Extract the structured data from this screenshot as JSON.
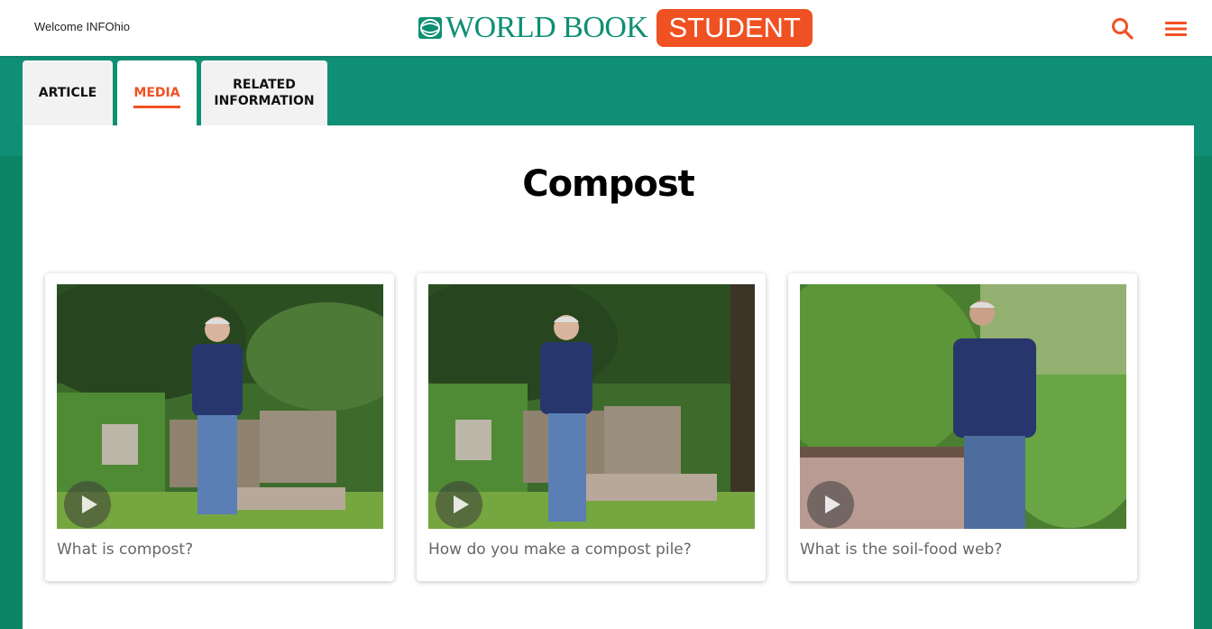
{
  "header": {
    "welcome": "Welcome INFOhio",
    "logo_text": "WORLD BOOK",
    "badge": "STUDENT",
    "brand_color": "#0e8f74",
    "accent_color": "#f05123",
    "search_icon": "search-icon",
    "menu_icon": "hamburger-menu-icon"
  },
  "tabs": [
    {
      "label": "ARTICLE"
    },
    {
      "label": "MEDIA",
      "active": true
    },
    {
      "label_line1": "RELATED",
      "label_line2": "INFORMATION"
    }
  ],
  "page_title": "Compost",
  "videos": [
    {
      "caption": "What is compost?",
      "icon": "play-icon"
    },
    {
      "caption": "How do you make a compost pile?",
      "icon": "play-icon"
    },
    {
      "caption": "What is the soil-food web?",
      "icon": "play-icon"
    }
  ]
}
